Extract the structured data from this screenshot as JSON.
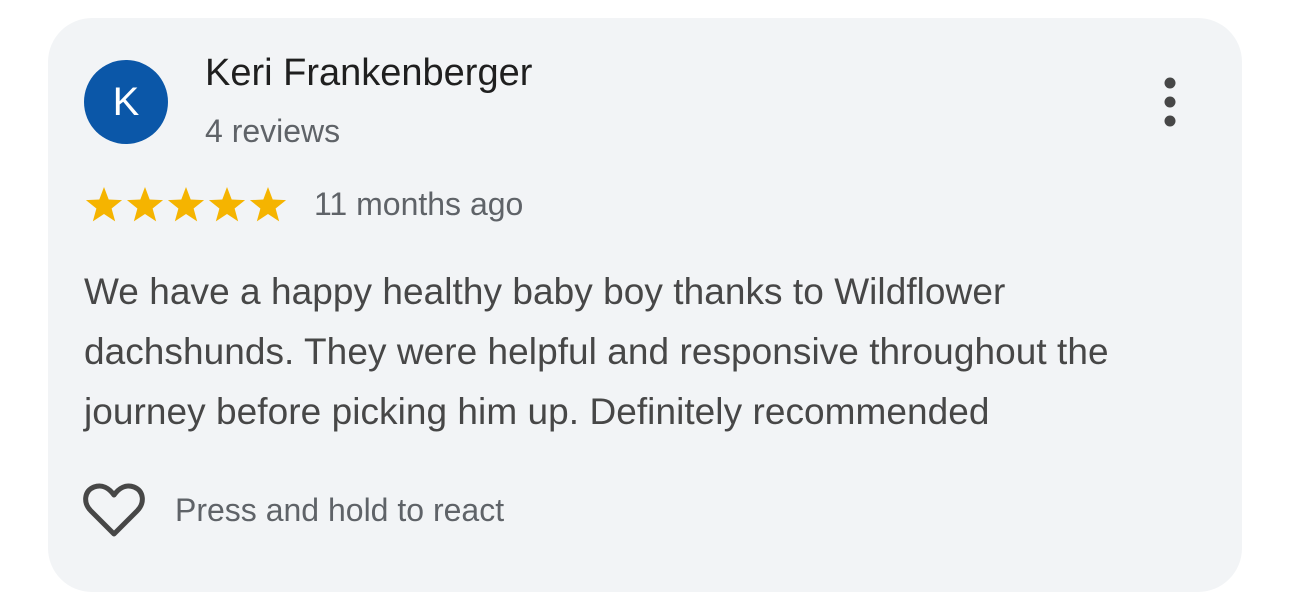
{
  "review": {
    "author": {
      "name": "Keri Frankenberger",
      "initial": "K",
      "review_count": "4 reviews"
    },
    "rating": 5,
    "max_rating": 5,
    "time_ago": "11 months ago",
    "text": "We have a happy healthy baby boy thanks to Wildflower dachshunds. They were helpful and responsive throughout the journey before picking him up. Definitely recommended",
    "react_label": "Press and hold to react"
  },
  "icons": {
    "more": "more-vert-icon",
    "star": "star-icon",
    "react": "heart-outline-icon"
  },
  "colors": {
    "card_background": "#f2f4f6",
    "avatar_background": "#0b57a8",
    "star": "#f5b400",
    "secondary_text": "#5f6368",
    "body_text": "#474747"
  }
}
